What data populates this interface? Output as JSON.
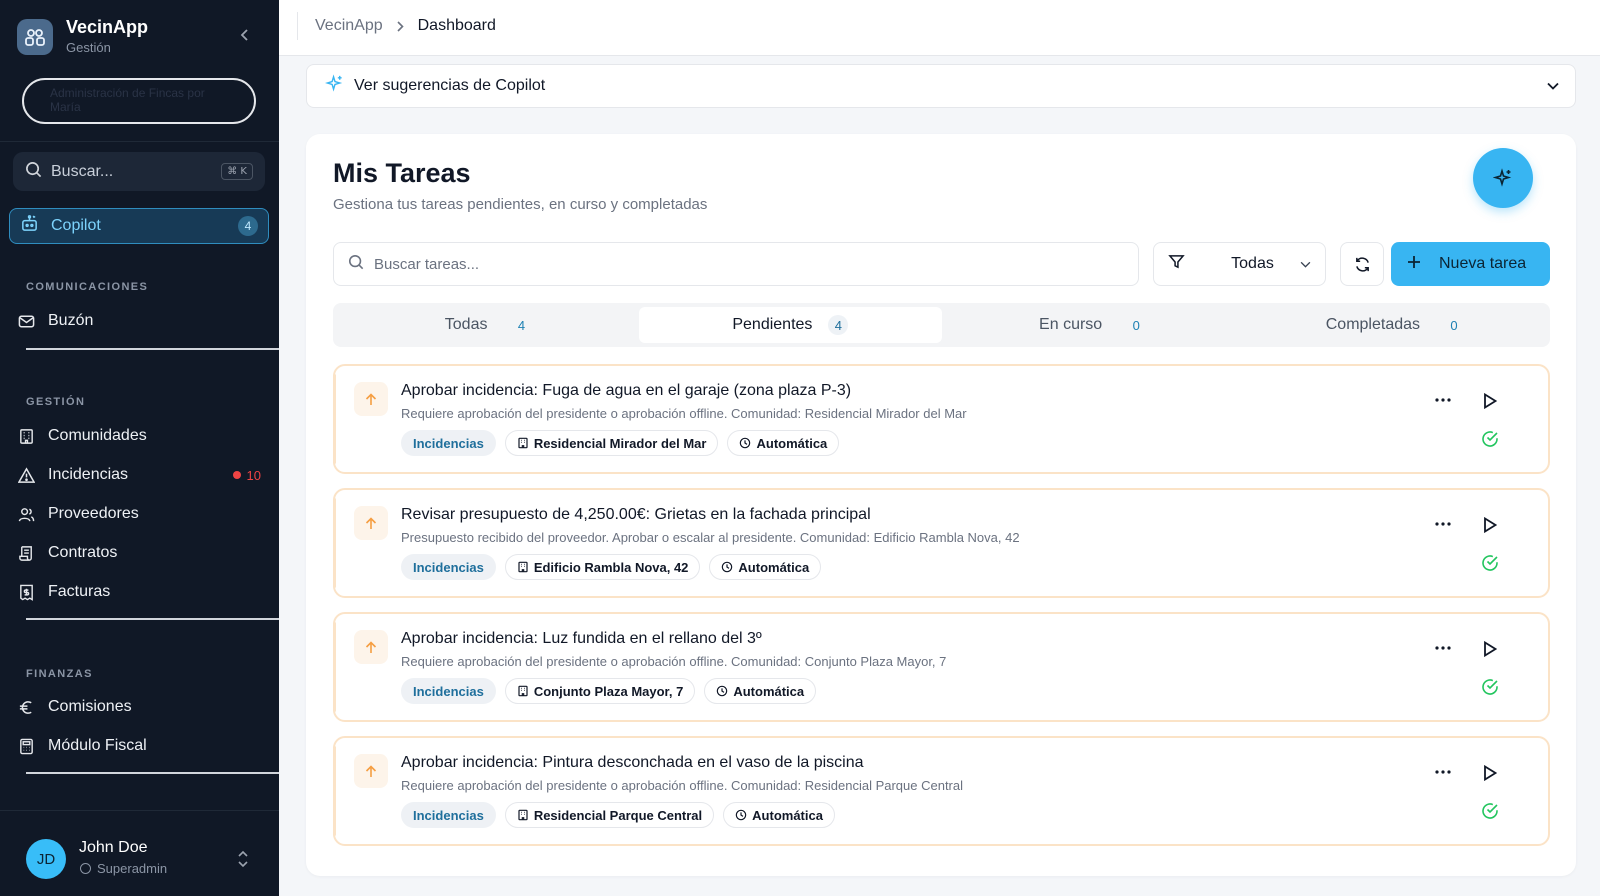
{
  "sidebar": {
    "brand_name": "VecinApp",
    "brand_sub": "Gestión",
    "pill_text": "Administración de Fincas por María",
    "search_label": "Buscar...",
    "search_shortcut": "⌘ K",
    "copilot": {
      "label": "Copilot",
      "badge": "4"
    },
    "sections": [
      {
        "title": "COMUNICACIONES",
        "items": [
          {
            "label": "Buzón",
            "icon": "mail-icon"
          }
        ]
      },
      {
        "title": "GESTIÓN",
        "items": [
          {
            "label": "Comunidades",
            "icon": "building-icon"
          },
          {
            "label": "Incidencias",
            "icon": "warning-icon",
            "count": "10"
          },
          {
            "label": "Proveedores",
            "icon": "users-icon"
          },
          {
            "label": "Contratos",
            "icon": "scroll-icon"
          },
          {
            "label": "Facturas",
            "icon": "receipt-icon"
          }
        ]
      },
      {
        "title": "FINANZAS",
        "items": [
          {
            "label": "Comisiones",
            "icon": "euro-icon"
          },
          {
            "label": "Módulo Fiscal",
            "icon": "calculator-icon"
          }
        ]
      }
    ],
    "user": {
      "initials": "JD",
      "name": "John Doe",
      "role": "Superadmin"
    }
  },
  "breadcrumb": {
    "root": "VecinApp",
    "current": "Dashboard"
  },
  "suggestions": {
    "label": "Ver sugerencias de Copilot"
  },
  "main": {
    "title": "Mis Tareas",
    "subtitle": "Gestiona tus tareas pendientes, en curso y completadas",
    "search_placeholder": "Buscar tareas...",
    "filter_value": "Todas",
    "new_task_label": "Nueva tarea",
    "tabs": [
      {
        "label": "Todas",
        "count": "4"
      },
      {
        "label": "Pendientes",
        "count": "4",
        "active": true
      },
      {
        "label": "En curso",
        "count": "0"
      },
      {
        "label": "Completadas",
        "count": "0"
      }
    ],
    "tasks": [
      {
        "title": "Aprobar incidencia: Fuga de agua en el garaje (zona plaza P-3)",
        "desc": "Requiere aprobación del presidente o aprobación offline. Comunidad: Residencial Mirador del Mar",
        "category": "Incidencias",
        "community": "Residencial Mirador del Mar",
        "mode": "Automática"
      },
      {
        "title": "Revisar presupuesto de 4,250.00€: Grietas en la fachada principal",
        "desc": "Presupuesto recibido del proveedor. Aprobar o escalar al presidente. Comunidad: Edificio Rambla Nova, 42",
        "category": "Incidencias",
        "community": "Edificio Rambla Nova, 42",
        "mode": "Automática"
      },
      {
        "title": "Aprobar incidencia: Luz fundida en el rellano del 3º",
        "desc": "Requiere aprobación del presidente o aprobación offline. Comunidad: Conjunto Plaza Mayor, 7",
        "category": "Incidencias",
        "community": "Conjunto Plaza Mayor, 7",
        "mode": "Automática"
      },
      {
        "title": "Aprobar incidencia: Pintura desconchada en el vaso de la piscina",
        "desc": "Requiere aprobación del presidente o aprobación offline. Comunidad: Residencial Parque Central",
        "category": "Incidencias",
        "community": "Residencial Parque Central",
        "mode": "Automática"
      }
    ]
  },
  "colors": {
    "accent": "#38b5f2",
    "sidebar_bg": "#101826",
    "priority": "#f59e42",
    "alert": "#ef4444",
    "success": "#22c55e"
  }
}
